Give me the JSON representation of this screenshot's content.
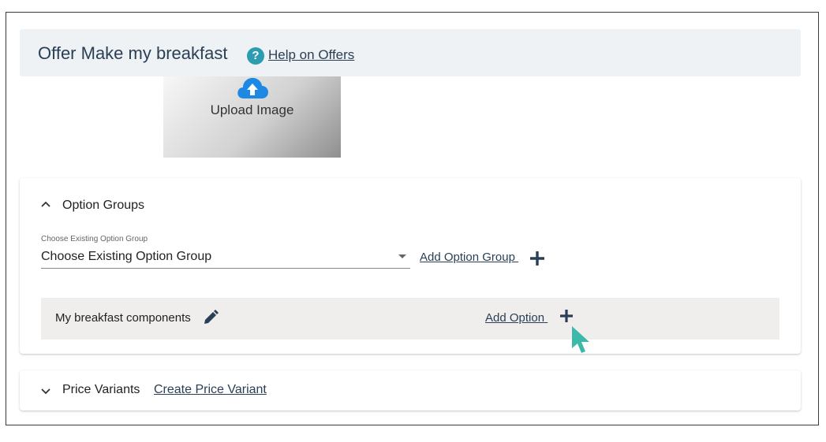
{
  "header": {
    "title": "Offer Make my breakfast",
    "help_link": "Help on Offers"
  },
  "upload": {
    "label": "Upload Image"
  },
  "option_groups": {
    "title": "Option Groups",
    "select_label": "Choose Existing Option Group",
    "select_value": "Choose Existing Option Group",
    "add_group_link": "Add Option Group ",
    "groups": [
      {
        "name": "My breakfast components",
        "add_option_link": "Add Option "
      }
    ]
  },
  "price_variants": {
    "title": "Price Variants",
    "create_link": "Create Price Variant"
  },
  "colors": {
    "accent": "#2a3f55",
    "help_icon": "#2c9cb0",
    "cursor": "#3cb9a9",
    "header_bg": "#eef2f5",
    "group_row_bg": "#f0eeec"
  },
  "icons": {
    "help": "help-circle-icon",
    "upload": "cloud-upload-icon",
    "collapse": "chevron-up-icon",
    "expand": "chevron-down-icon",
    "add": "plus-icon",
    "edit": "pencil-icon",
    "cursor": "mouse-pointer-icon"
  }
}
